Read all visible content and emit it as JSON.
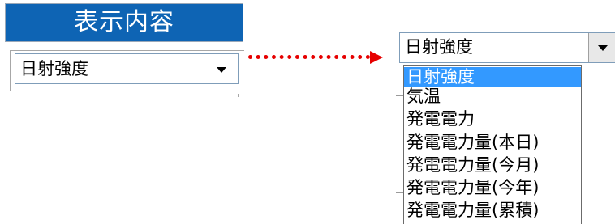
{
  "left_panel": {
    "header": "表示内容",
    "select": {
      "value": "日射強度"
    }
  },
  "dropdown": {
    "value": "日射強度",
    "options": [
      "日射強度",
      "気温",
      "発電電力",
      "発電電力量(本日)",
      "発電電力量(今月)",
      "発電電力量(今年)",
      "発電電力量(累積)"
    ],
    "selected_option": "日射強度"
  },
  "colors": {
    "header_bg": "#0e64b4",
    "arrow": "#e60000",
    "highlight": "#3399ff"
  },
  "icons": {
    "connector": "dotted-right-arrow",
    "dropdown": "chevron-down-icon"
  }
}
